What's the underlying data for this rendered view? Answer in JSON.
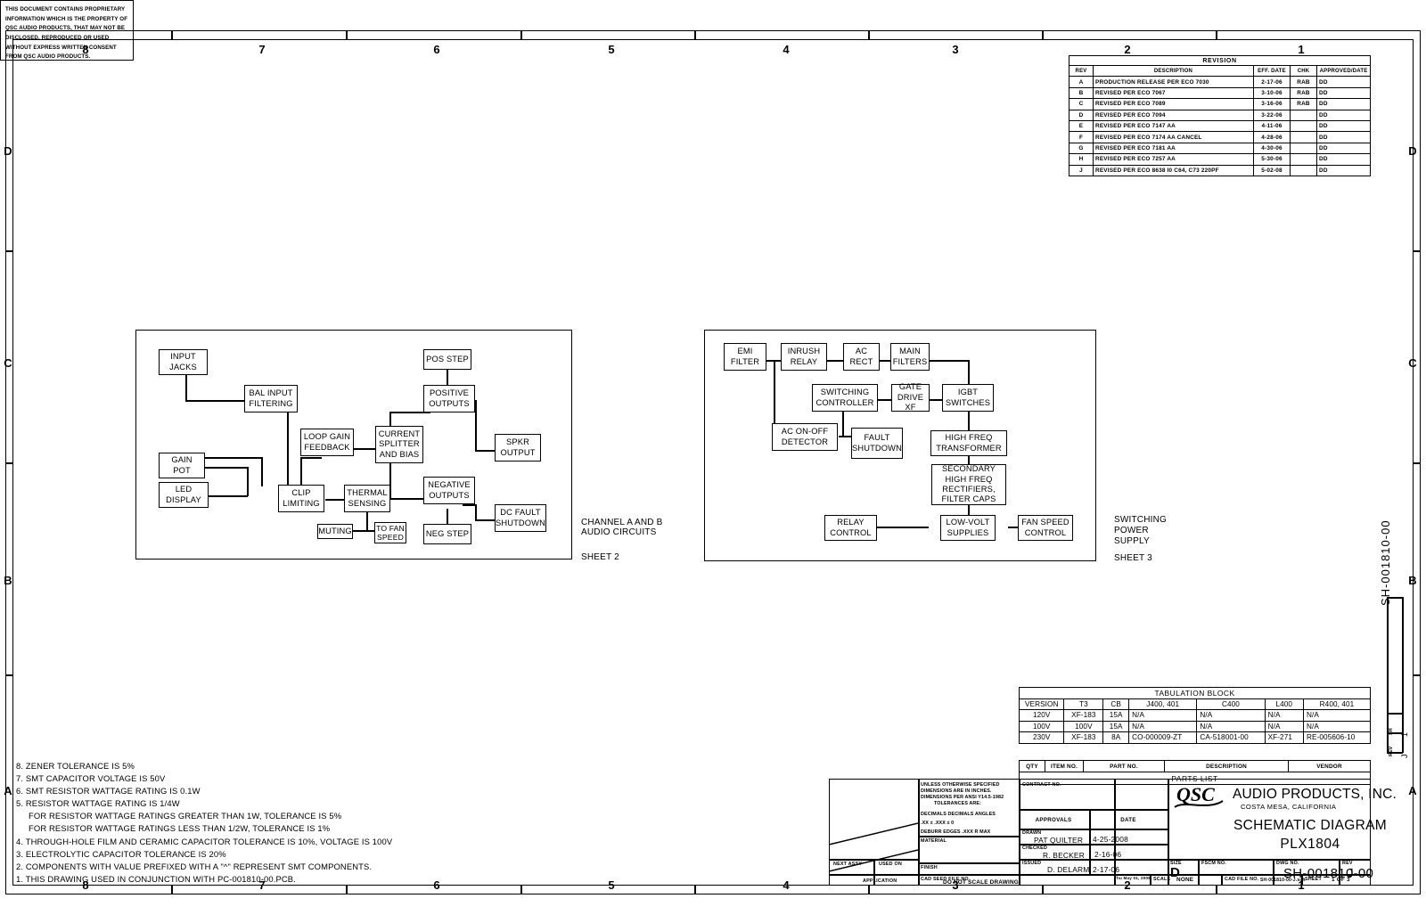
{
  "sheet": {
    "zone_columns": [
      "8",
      "7",
      "6",
      "5",
      "4",
      "3",
      "2",
      "1"
    ],
    "zone_rows": [
      "D",
      "C",
      "B",
      "A"
    ]
  },
  "proprietary_notice": "THIS DOCUMENT CONTAINS PROPRIETARY INFORMATION WHICH IS THE PROPERTY OF QSC AUDIO PRODUCTS, THAT MAY NOT BE DISCLOSED, REPRODUCED OR USED WITHOUT EXPRESS WRITTEN CONSENT FROM QSC AUDIO PRODUCTS.",
  "revision": {
    "title": "REVISION",
    "headers": [
      "REV",
      "DESCRIPTION",
      "EFF. DATE",
      "CHK",
      "APPROVED/DATE"
    ],
    "rows": [
      {
        "rev": "A",
        "description": "PRODUCTION RELEASE PER ECO 7030",
        "eff_date": "2-17-06",
        "chk": "RAB",
        "approved": "DD"
      },
      {
        "rev": "B",
        "description": "REVISED PER ECO 7067",
        "eff_date": "3-10-06",
        "chk": "RAB",
        "approved": "DD"
      },
      {
        "rev": "C",
        "description": "REVISED PER ECO 7089",
        "eff_date": "3-16-06",
        "chk": "RAB",
        "approved": "DD"
      },
      {
        "rev": "D",
        "description": "REVISED PER ECO 7094",
        "eff_date": "3-22-06",
        "chk": "",
        "approved": "DD"
      },
      {
        "rev": "E",
        "description": "REVISED PER ECO 7147 AA",
        "eff_date": "4-11-06",
        "chk": "",
        "approved": "DD"
      },
      {
        "rev": "F",
        "description": "REVISED PER ECO 7174 AA          CANCEL",
        "eff_date": "4-28-06",
        "chk": "",
        "approved": "DD"
      },
      {
        "rev": "G",
        "description": "REVISED PER ECO 7181 AA",
        "eff_date": "4-30-06",
        "chk": "",
        "approved": "DD"
      },
      {
        "rev": "H",
        "description": "REVISED PER ECO 7257 AA",
        "eff_date": "5-30-06",
        "chk": "",
        "approved": "DD"
      },
      {
        "rev": "J",
        "description": "REVISED PER ECO 8638 I0 C64, C73 220PF",
        "eff_date": "5-02-08",
        "chk": "",
        "approved": "DD"
      }
    ]
  },
  "diagram_audio": {
    "caption_line1": "CHANNEL A AND B",
    "caption_line2": "AUDIO CIRCUITS",
    "caption_sheet": "SHEET 2",
    "blocks": {
      "input_jacks": "INPUT\nJACKS",
      "bal_input_filtering": "BAL INPUT\nFILTERING",
      "gain_pot": "GAIN\nPOT",
      "led_display": "LED\nDISPLAY",
      "loop_gain_feedback": "LOOP GAIN\nFEEDBACK",
      "clip_limiting": "CLIP\nLIMITING",
      "thermal_sensing": "THERMAL\nSENSING",
      "muting": "MUTING",
      "to_fan_speed": "TO FAN\nSPEED",
      "current_splitter": "CURRENT\nSPLITTER\nAND BIAS",
      "pos_step": "POS STEP",
      "positive_outputs": "POSITIVE\nOUTPUTS",
      "negative_outputs": "NEGATIVE\nOUTPUTS",
      "neg_step": "NEG STEP",
      "spkr_output": "SPKR\nOUTPUT",
      "dc_fault_shutdown": "DC FAULT\nSHUTDOWN"
    }
  },
  "diagram_psu": {
    "caption_line1": "SWITCHING",
    "caption_line2": "POWER",
    "caption_line3": "SUPPLY",
    "caption_sheet": "SHEET 3",
    "blocks": {
      "emi_filter": "EMI\nFILTER",
      "inrush_relay": "INRUSH\nRELAY",
      "ac_rect": "AC\nRECT",
      "main_filters": "MAIN\nFILTERS",
      "switching_controller": "SWITCHING\nCONTROLLER",
      "gate_drive_xf": "GATE\nDRIVE XF",
      "igbt_switches": "IGBT\nSWITCHES",
      "ac_on_off_detector": "AC ON-OFF\nDETECTOR",
      "fault_shutdown": "FAULT\nSHUTDOWN",
      "high_freq_transformer": "HIGH FREQ\nTRANSFORMER",
      "secondary_rectifiers": "SECONDARY\nHIGH FREQ\nRECTIFIERS,\nFILTER CAPS",
      "relay_control": "RELAY\nCONTROL",
      "low_volt_supplies": "LOW-VOLT\nSUPPLIES",
      "fan_speed_control": "FAN SPEED\nCONTROL"
    }
  },
  "notes": [
    "8. ZENER TOLERANCE IS 5%",
    "7. SMT CAPACITOR VOLTAGE IS 50V",
    "6. SMT RESISTOR WATTAGE RATING IS 0.1W",
    "5. RESISTOR WATTAGE RATING IS 1/4W",
    "FOR RESISTOR WATTAGE RATINGS GREATER THAN 1W, TOLERANCE IS 5%",
    "FOR RESISTOR WATTAGE RATINGS LESS THAN 1/2W, TOLERANCE IS 1%",
    "4. THROUGH-HOLE FILM AND CERAMIC CAPACITOR TOLERANCE IS 10%, VOLTAGE IS 100V",
    "3. ELECTROLYTIC CAPACITOR TOLERANCE IS 20%",
    "2. COMPONENTS WITH VALUE PREFIXED WITH A \"^\" REPRESENT SMT COMPONENTS.",
    "1. THIS DRAWING USED IN CONJUNCTION WITH PC-001810-00.PCB."
  ],
  "tabulation_block": {
    "title": "TABULATION BLOCK",
    "headers": [
      "VERSION",
      "T3",
      "CB",
      "J400, 401",
      "C400",
      "L400",
      "R400, 401"
    ],
    "rows": [
      [
        "120V",
        "XF-183",
        "15A",
        "N/A",
        "N/A",
        "N/A",
        "N/A"
      ],
      [
        "100V",
        "100V",
        "15A",
        "N/A",
        "N/A",
        "N/A",
        "N/A"
      ],
      [
        "230V",
        "XF-183",
        "8A",
        "CO-000009-ZT",
        "CA-518001-00",
        "XF-271",
        "RE-005606-10"
      ]
    ]
  },
  "parts_list": {
    "headers": [
      "QTY",
      "ITEM NO.",
      "PART NO.",
      "DESCRIPTION",
      "VENDOR"
    ],
    "title": "PARTS LIST"
  },
  "title_block": {
    "spec_lines": [
      "UNLESS OTHERWISE SPECIFIED",
      "DIMENSIONS ARE IN INCHES.",
      "DIMENSIONS PER ANSI Y14.5-1982",
      "TOLERANCES ARE:",
      "DECIMALS      DECIMALS          ANGLES",
      ".XX ±            .XXX ±                     0",
      "DEBURR EDGES .XXX R MAX"
    ],
    "material_label": "MATERIAL",
    "finish_label": "FINISH",
    "next_assy_label": "NEXT ASSY",
    "used_on_label": "USED ON",
    "application_label": "APPLICATION",
    "cad_seed_label": "CAD SEED FILE NO.",
    "do_not_scale": "DO NOT SCALE DRAWING",
    "contract_label": "CONTRACT NO.",
    "approvals_header": "APPROVALS",
    "date_header": "DATE",
    "drawn_label": "DRAWN",
    "drawn_name": "PAT QUILTER",
    "drawn_date": "4-25-2008",
    "checked_label": "CHECKED",
    "checked_name": "R. BECKER",
    "checked_date": "2-16-06",
    "issued_label": "ISSUED",
    "issued_name": "D. DELARM",
    "issued_date": "2-17-06",
    "logo_text": "QSC",
    "company_name": "AUDIO PRODUCTS, INC.",
    "company_city": "COSTA MESA, CALIFORNIA",
    "drawing_title": "SCHEMATIC DIAGRAM",
    "drawing_model": "PLX1804",
    "size_label": "SIZE",
    "size_value": "D",
    "fscm_label": "FSCM NO.",
    "fscm_value": "",
    "dwg_no_label": "DWG NO.",
    "dwg_no_value": "SH-001810-00",
    "rev_label": "REV",
    "rev_value": "J",
    "scale_label": "SCALE",
    "scale_value": "NONE",
    "cad_file_label": "CAD FILE NO.",
    "cad_file_value": "SH-001810-00-J.sch",
    "sheet_label": "SHEET",
    "sheet_value": "1  OF  3",
    "plot_stamp": "Thu May 01, 2008"
  },
  "edge_vertical": {
    "dwg_no": "SH-001810-00",
    "rev_label": "REV",
    "rev_value": "J",
    "sheet_label": "SH",
    "sheet_value": "1",
    "size_label": "SIZE",
    "size_value": "D"
  }
}
